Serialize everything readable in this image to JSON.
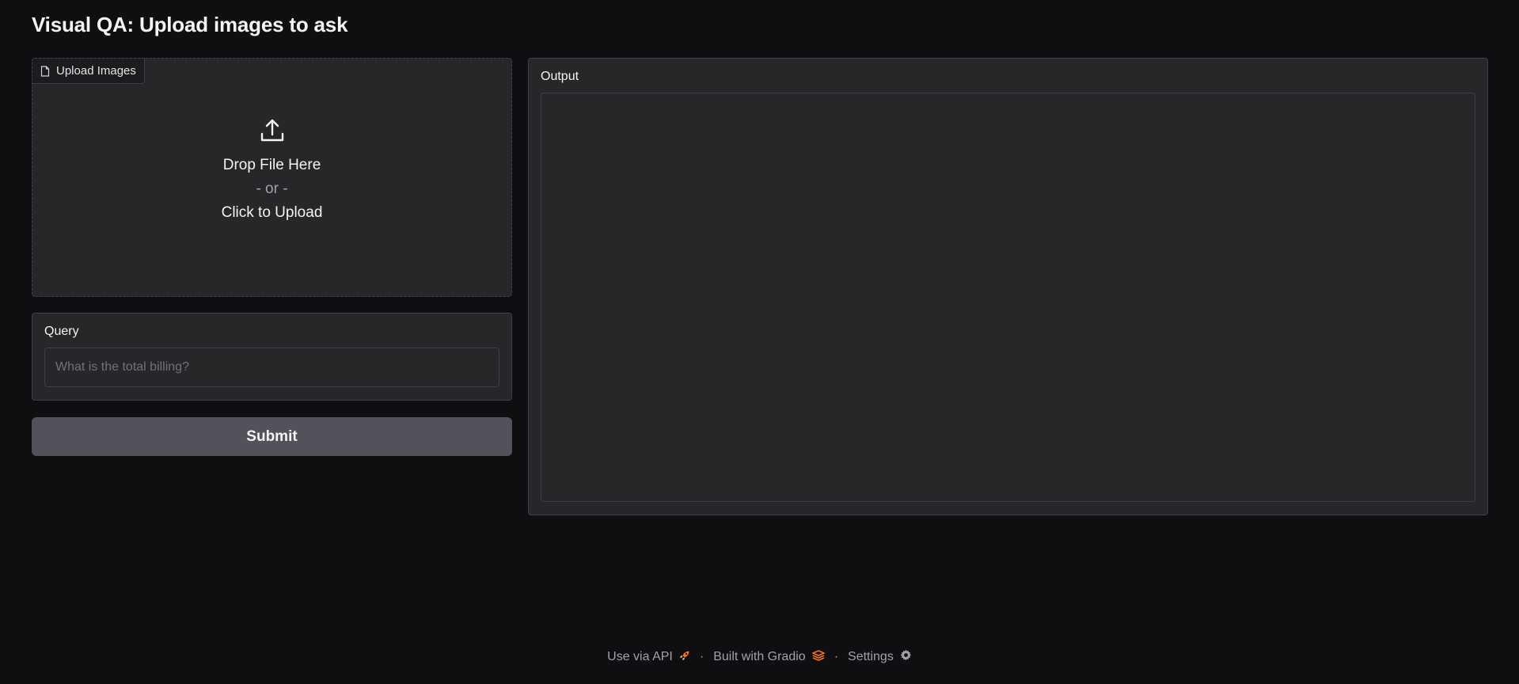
{
  "header": {
    "title": "Visual QA: Upload images to ask"
  },
  "upload": {
    "label": "Upload Images",
    "drop_text": "Drop File Here",
    "or_text": "- or -",
    "click_text": "Click to Upload"
  },
  "query": {
    "label": "Query",
    "placeholder": "What is the total billing?",
    "value": ""
  },
  "submit": {
    "label": "Submit"
  },
  "output": {
    "label": "Output",
    "value": ""
  },
  "footer": {
    "api_label": "Use via API",
    "gradio_label": "Built with Gradio",
    "settings_label": "Settings",
    "separator": "·"
  },
  "icons": {
    "upload_label_icon": "file-icon",
    "dropzone_icon": "upload-icon",
    "api_icon": "rocket-icon",
    "gradio_icon": "gradio-logo-icon",
    "settings_icon": "gear-icon"
  },
  "colors": {
    "background": "#0f0f11",
    "panel": "#27272a",
    "border": "#3f3f46",
    "submit": "#52525b",
    "accent_orange": "#f97316"
  }
}
